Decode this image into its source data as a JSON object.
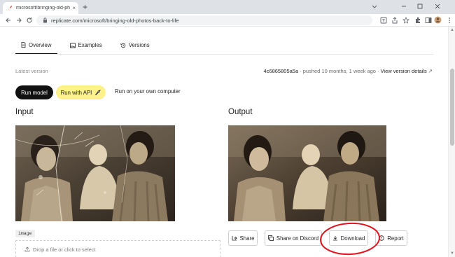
{
  "browser": {
    "tab_title": "microsoft/bringing-old-photos",
    "tab_close": "×",
    "new_tab": "+",
    "url": "replicate.com/microsoft/bringing-old-photos-back-to-life"
  },
  "subnav": {
    "items": [
      {
        "label": "Overview",
        "icon": "document-icon",
        "active": true
      },
      {
        "label": "Examples",
        "icon": "image-icon",
        "active": false
      },
      {
        "label": "Versions",
        "icon": "history-icon",
        "active": false
      }
    ]
  },
  "version": {
    "label": "Latest version",
    "hash": "4c6865805a5a",
    "pushed": "· pushed 10 months, 1 week ago ·",
    "details_link": "View version details",
    "details_arrow": "↗"
  },
  "run": {
    "run_model": "Run model",
    "run_api": "Run with API",
    "run_local": "Run on your own computer"
  },
  "input": {
    "heading": "Input",
    "param_name": "image",
    "dropzone_text": "Drop a file or click to select"
  },
  "output": {
    "heading": "Output",
    "share": "Share",
    "share_discord": "Share on Discord",
    "download": "Download",
    "report": "Report"
  },
  "colors": {
    "accent_yellow": "#fdf28a",
    "annotation_red": "#e0141e",
    "primary_button": "#111111"
  }
}
